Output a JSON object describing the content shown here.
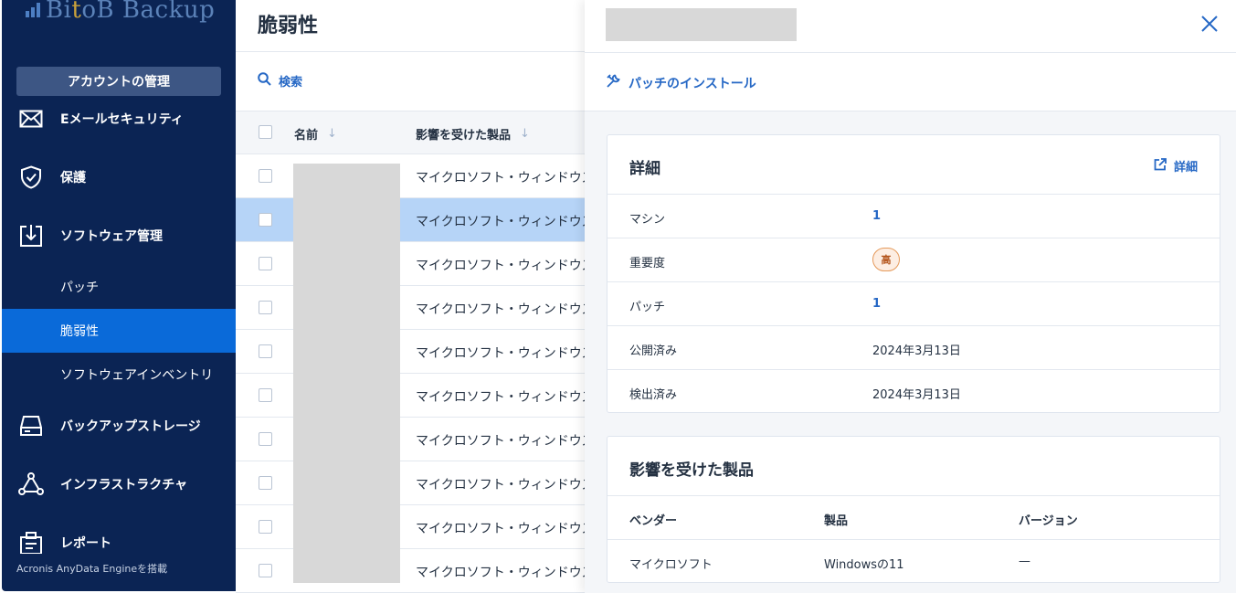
{
  "sidebar": {
    "brand": {
      "part1": "Bi",
      "part2": "t",
      "part3": "oB Backup"
    },
    "account_button": "アカウントの管理",
    "items": [
      {
        "label": "Eメールセキュリティ",
        "icon": "envelope-icon"
      },
      {
        "label": "保護",
        "icon": "shield-icon"
      },
      {
        "label": "ソフトウェア管理",
        "icon": "software-download-icon"
      },
      {
        "label": "バックアップストレージ",
        "icon": "storage-drive-icon"
      },
      {
        "label": "インフラストラクチャ",
        "icon": "network-triangle-icon"
      },
      {
        "label": "レポート",
        "icon": "report-icon"
      }
    ],
    "subitems": [
      {
        "label": "パッチ",
        "active": false
      },
      {
        "label": "脆弱性",
        "active": true
      },
      {
        "label": "ソフトウェアインベントリ",
        "active": false
      }
    ],
    "footer": "Acronis AnyData Engineを搭載"
  },
  "main": {
    "title": "脆弱性",
    "search_label": "検索",
    "columns": {
      "name": "名前",
      "product": "影響を受けた製品"
    },
    "rows": [
      {
        "product": "マイクロソフト・ウィンドウズ",
        "selected": false
      },
      {
        "product": "マイクロソフト・ウィンドウズ",
        "selected": true
      },
      {
        "product": "マイクロソフト・ウィンドウズ",
        "selected": false
      },
      {
        "product": "マイクロソフト・ウィンドウズ",
        "selected": false
      },
      {
        "product": "マイクロソフト・ウィンドウズ",
        "selected": false
      },
      {
        "product": "マイクロソフト・ウィンドウズ",
        "selected": false
      },
      {
        "product": "マイクロソフト・ウィンドウズ",
        "selected": false
      },
      {
        "product": "マイクロソフト・ウィンドウズ",
        "selected": false
      },
      {
        "product": "マイクロソフト・ウィンドウズ",
        "selected": false
      },
      {
        "product": "マイクロソフト・ウィンドウズ",
        "selected": false
      }
    ]
  },
  "panel": {
    "install_patch": "パッチのインストール",
    "details": {
      "title": "詳細",
      "link": "詳細",
      "rows": {
        "machine_label": "マシン",
        "machine_value": "1",
        "severity_label": "重要度",
        "severity_value": "高",
        "patch_label": "パッチ",
        "patch_value": "1",
        "published_label": "公開済み",
        "published_value": "2024年3月13日",
        "detected_label": "検出済み",
        "detected_value": "2024年3月13日"
      }
    },
    "affected": {
      "title": "影響を受けた製品",
      "headers": {
        "vendor": "ベンダー",
        "product": "製品",
        "version": "バージョン"
      },
      "row": {
        "vendor": "マイクロソフト",
        "product": "Windowsの11",
        "version": "—"
      }
    }
  },
  "colors": {
    "sidebar_bg": "#0b2454",
    "active_nav": "#0a6ad9",
    "accent_link": "#2668c5",
    "selected_row": "#b6d4f7",
    "severity_high": "#e59a5b"
  }
}
